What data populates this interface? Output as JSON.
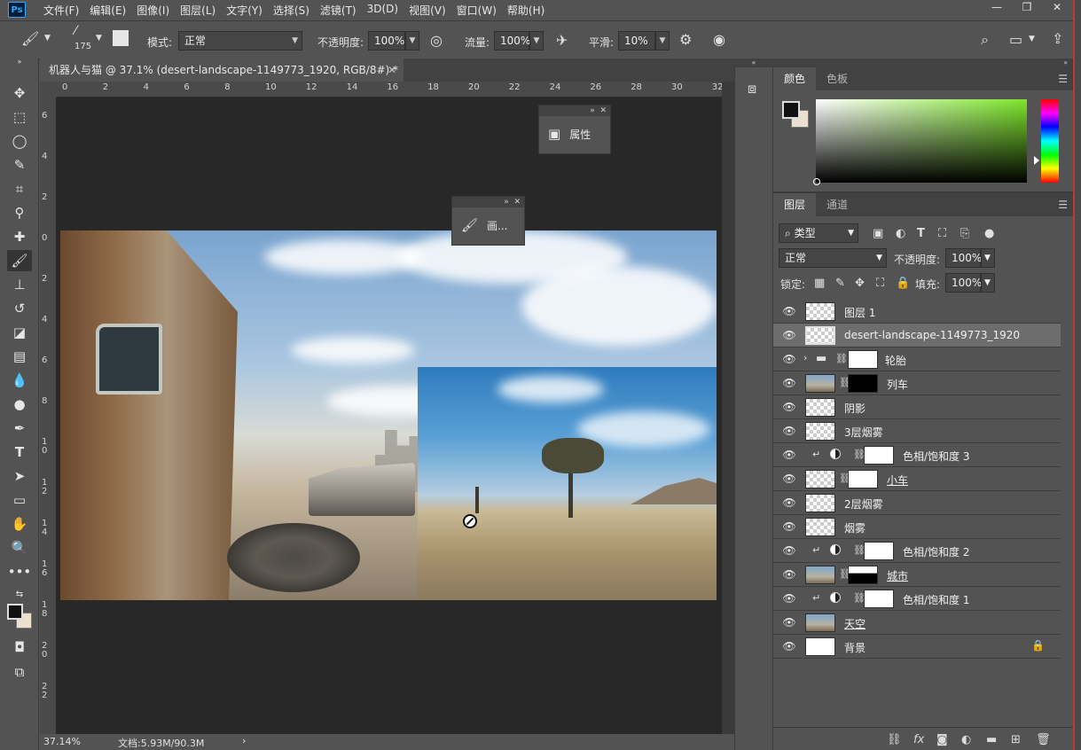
{
  "app": {
    "logo": "Ps",
    "menus": [
      "文件(F)",
      "编辑(E)",
      "图像(I)",
      "图层(L)",
      "文字(Y)",
      "选择(S)",
      "滤镜(T)",
      "3D(D)",
      "视图(V)",
      "窗口(W)",
      "帮助(H)"
    ],
    "window_controls": [
      "—",
      "❐",
      "✕"
    ]
  },
  "options": {
    "brush_size": "175",
    "mode_label": "模式:",
    "mode_value": "正常",
    "opacity_label": "不透明度:",
    "opacity_value": "100%",
    "flow_label": "流量:",
    "flow_value": "100%",
    "smooth_label": "平滑:",
    "smooth_value": "10%"
  },
  "document": {
    "tab_title": "机器人与猫 @ 37.1% (desert-landscape-1149773_1920, RGB/8#) *",
    "close": "✕",
    "zoom": "37.14%",
    "doc_info": "文档:5.93M/90.3M",
    "ruler_top": [
      "0",
      "2",
      "4",
      "6",
      "8",
      "10",
      "12",
      "14",
      "16",
      "18",
      "20",
      "22",
      "24",
      "26",
      "28",
      "30",
      "32"
    ],
    "ruler_left": [
      "6",
      "4",
      "2",
      "0",
      "2",
      "4",
      "6",
      "8",
      "1 0",
      "1 2",
      "1 4",
      "1 6",
      "1 8",
      "2 0",
      "2 2"
    ]
  },
  "floating": {
    "properties_label": "属性",
    "brush_panel_label": "画..."
  },
  "color_panel": {
    "tabs": [
      "颜色",
      "色板"
    ],
    "fg_color": "#111111",
    "bg_color": "#ece1d1"
  },
  "layers_panel": {
    "tabs": [
      "图层",
      "通道"
    ],
    "filter_label": "类型",
    "blend_mode": "正常",
    "opacity_label": "不透明度:",
    "opacity_value": "100%",
    "lock_label": "锁定:",
    "fill_label": "填充:",
    "fill_value": "100%",
    "layers": [
      {
        "name": "图层 1"
      },
      {
        "name": "desert-landscape-1149773_1920"
      },
      {
        "name": "轮胎"
      },
      {
        "name": "列车"
      },
      {
        "name": "阴影"
      },
      {
        "name": "3层烟雾"
      },
      {
        "name": "色相/饱和度 3"
      },
      {
        "name": "小车"
      },
      {
        "name": "2层烟雾"
      },
      {
        "name": "烟雾"
      },
      {
        "name": "色相/饱和度 2"
      },
      {
        "name": "城市"
      },
      {
        "name": "色相/饱和度 1"
      },
      {
        "name": "天空"
      },
      {
        "name": "背景"
      }
    ]
  }
}
